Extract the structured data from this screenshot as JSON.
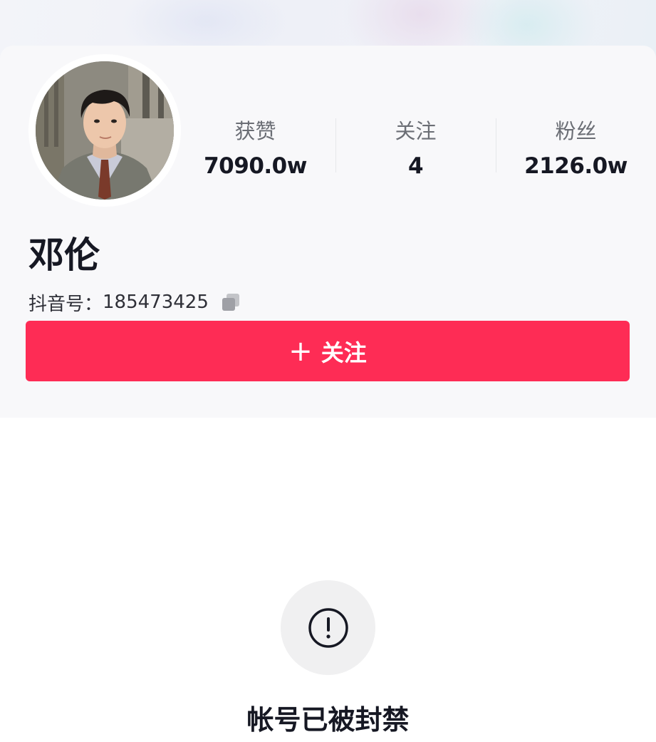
{
  "profile": {
    "name": "邓伦",
    "uid_label": "抖音号：",
    "uid_value": "185473425",
    "avatar_icon": "avatar-photo"
  },
  "stats": [
    {
      "label": "获赞",
      "value": "7090.0w"
    },
    {
      "label": "关注",
      "value": "4"
    },
    {
      "label": "粉丝",
      "value": "2126.0w"
    }
  ],
  "actions": {
    "follow_plus": "+",
    "follow_label": "关注"
  },
  "status": {
    "icon": "exclamation-circle-icon",
    "message": "帐号已被封禁"
  },
  "colors": {
    "accent": "#fe2c55",
    "card_bg": "#f8f8fa",
    "text_primary": "#161823",
    "text_secondary": "#6b6e75"
  }
}
